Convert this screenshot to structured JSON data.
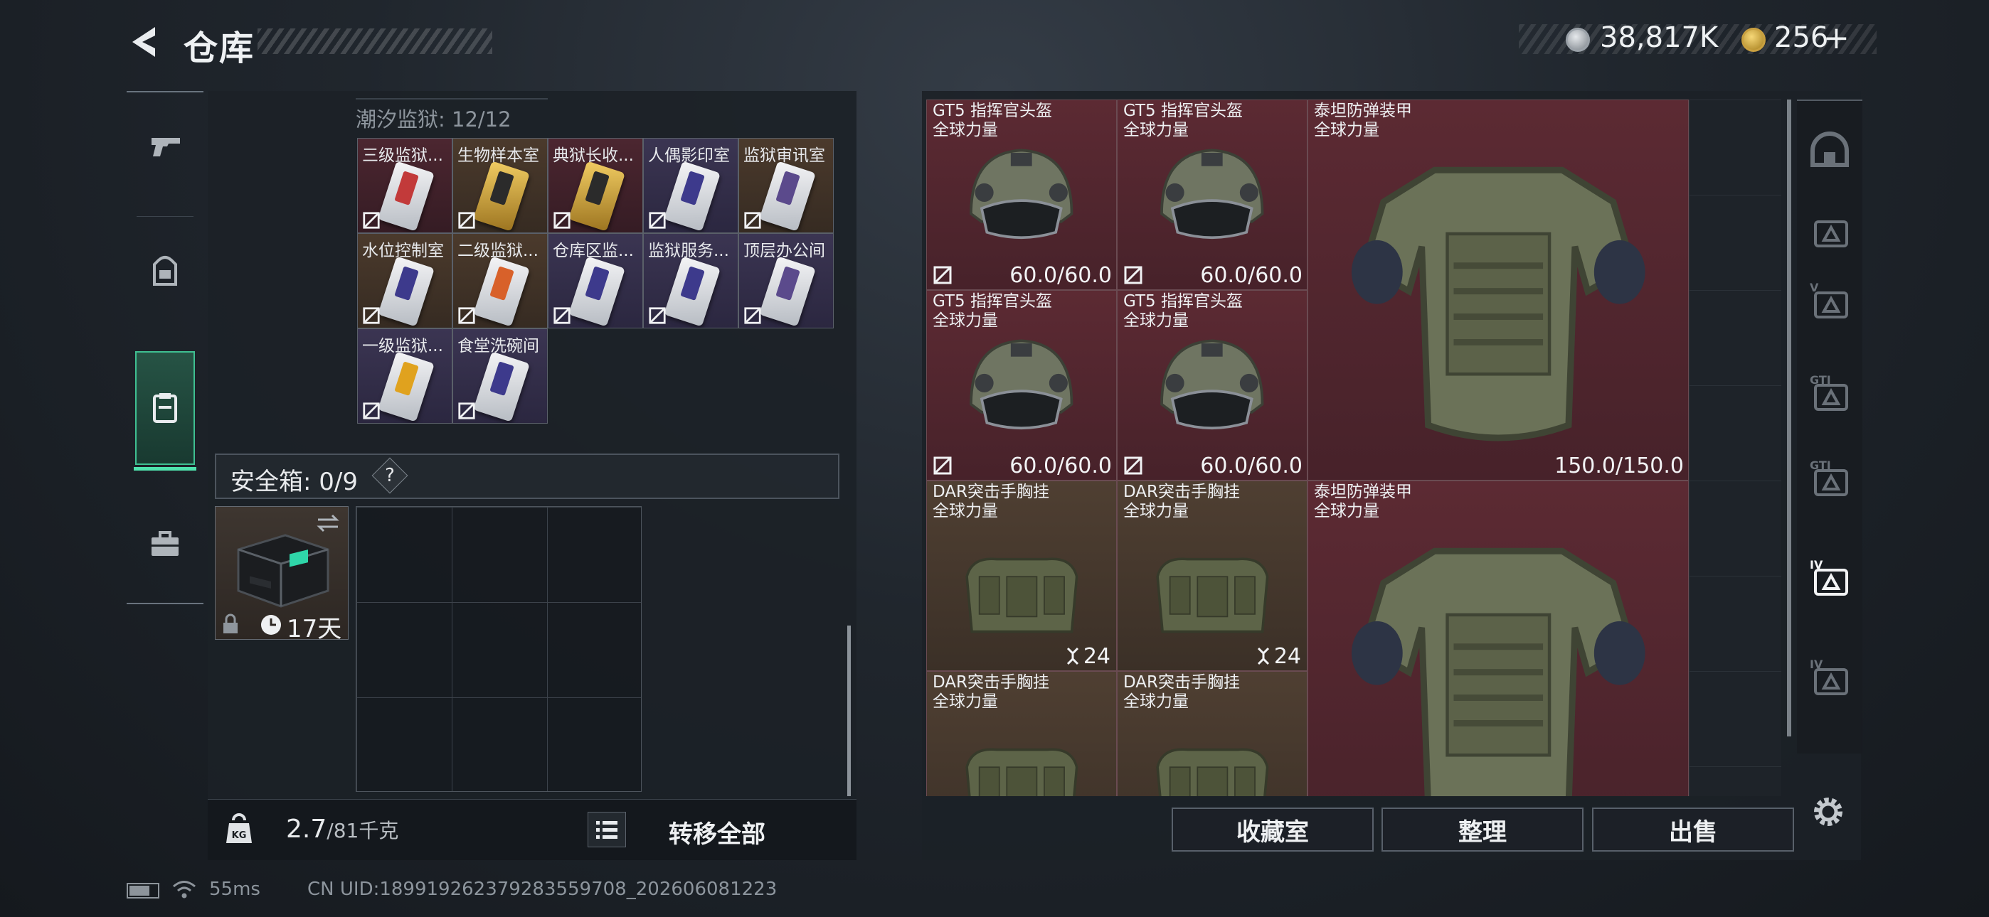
{
  "header": {
    "title": "仓库",
    "currency_silver": "38,817K",
    "currency_gold": "256",
    "gold_plus": "+"
  },
  "left_nav": [
    {
      "name": "weapons",
      "icon": "pistol-icon",
      "active": false
    },
    {
      "name": "gear",
      "icon": "backpack-icon",
      "active": false
    },
    {
      "name": "containers",
      "icon": "case-icon",
      "active": true
    },
    {
      "name": "supplies",
      "icon": "briefcase-icon",
      "active": false
    }
  ],
  "stash": {
    "label": "潮汐监狱: 12/12",
    "items": [
      {
        "label": "三级监狱...",
        "bg": "red",
        "accent": "#c23a3a"
      },
      {
        "label": "生物样本室",
        "bg": "brown",
        "accent": "#2b2b2b",
        "gold": true
      },
      {
        "label": "典狱长收...",
        "bg": "red",
        "accent": "#2b2b2b",
        "gold": true
      },
      {
        "label": "人偶影印室",
        "bg": "purple",
        "accent": "#3d3a8c"
      },
      {
        "label": "监狱审讯室",
        "bg": "brown",
        "accent": "#5b4a8c"
      },
      {
        "label": "水位控制室",
        "bg": "brown",
        "accent": "#3d3a8c"
      },
      {
        "label": "二级监狱...",
        "bg": "brown",
        "accent": "#d8612a"
      },
      {
        "label": "仓库区监...",
        "bg": "purple",
        "accent": "#3d3a8c"
      },
      {
        "label": "监狱服务...",
        "bg": "purple",
        "accent": "#3d3a8c"
      },
      {
        "label": "顶层办公间",
        "bg": "purple",
        "accent": "#5b4a8c"
      },
      {
        "label": "一级监狱...",
        "bg": "purple",
        "accent": "#e0a21e"
      },
      {
        "label": "食堂洗碗间",
        "bg": "purple",
        "accent": "#3d3a8c"
      }
    ]
  },
  "safe": {
    "label": "安全箱: 0/9",
    "help": "?",
    "remaining": "17天"
  },
  "weight": {
    "current": "2.7",
    "max": "/81千克"
  },
  "transfer_label": "转移全部",
  "warehouse_items": [
    {
      "name": "GT5 指挥官头盔",
      "sub": "全球力量",
      "kind": "helmet",
      "bg": "red",
      "durability": "60.0/60.0"
    },
    {
      "name": "GT5 指挥官头盔",
      "sub": "全球力量",
      "kind": "helmet",
      "bg": "red",
      "durability": "60.0/60.0"
    },
    {
      "name": "GT5 指挥官头盔",
      "sub": "全球力量",
      "kind": "helmet",
      "bg": "red",
      "durability": "60.0/60.0"
    },
    {
      "name": "GT5 指挥官头盔",
      "sub": "全球力量",
      "kind": "helmet",
      "bg": "red",
      "durability": "60.0/60.0"
    },
    {
      "name": "泰坦防弹装甲",
      "sub": "全球力量",
      "kind": "armor",
      "bg": "red",
      "durability": "150.0/150.0"
    },
    {
      "name": "DAR突击手胸挂",
      "sub": "全球力量",
      "kind": "rig",
      "bg": "brown",
      "capacity": "24"
    },
    {
      "name": "DAR突击手胸挂",
      "sub": "全球力量",
      "kind": "rig",
      "bg": "brown",
      "capacity": "24"
    },
    {
      "name": "泰坦防弹装甲",
      "sub": "全球力量",
      "kind": "armor",
      "bg": "red",
      "durability": ""
    },
    {
      "name": "DAR突击手胸挂",
      "sub": "全球力量",
      "kind": "rig",
      "bg": "brown",
      "capacity": ""
    },
    {
      "name": "DAR突击手胸挂",
      "sub": "全球力量",
      "kind": "rig",
      "bg": "brown",
      "capacity": ""
    }
  ],
  "filter_nav": [
    {
      "icon": "all-items-icon",
      "text": ""
    },
    {
      "icon": "filter-icon-1",
      "text": ""
    },
    {
      "icon": "filter-icon-2",
      "text": "V"
    },
    {
      "icon": "filter-icon-3",
      "text": "GTI"
    },
    {
      "icon": "filter-icon-4",
      "text": "GTI"
    },
    {
      "icon": "filter-icon-5",
      "text": "IV"
    },
    {
      "icon": "filter-icon-6",
      "text": "IV"
    }
  ],
  "buttons": {
    "vault": "收藏室",
    "sort": "整理",
    "sell": "出售"
  },
  "status": {
    "ping": "55ms",
    "uid": "CN UID:18991926237928355​9708_202606081223"
  }
}
